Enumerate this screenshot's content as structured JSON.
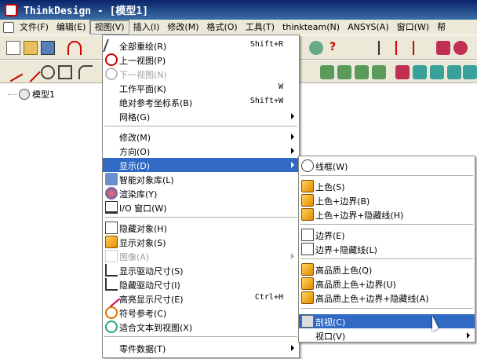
{
  "window": {
    "title": "ThinkDesign  - [模型1]"
  },
  "menubar": {
    "items": [
      "文件(F)",
      "编辑(E)",
      "视图(V)",
      "插入(I)",
      "修改(M)",
      "格式(O)",
      "工具(T)",
      "thinkteam(N)",
      "ANSYS(A)",
      "窗口(W)",
      "帮"
    ]
  },
  "tree": {
    "root_label": "模型1"
  },
  "view_menu": {
    "items": [
      {
        "label": "全部重绘(R)",
        "shortcut": "Shift+R",
        "icon": "redraw-icon"
      },
      {
        "label": "上一视图(P)",
        "icon": "previous-view-icon"
      },
      {
        "label": "下一视图(N)",
        "icon": "next-view-icon",
        "disabled": true
      },
      {
        "label": "工作平面(K)",
        "shortcut": "W"
      },
      {
        "label": "绝对参考坐标系(B)",
        "shortcut": "Shift+W"
      },
      {
        "label": "网格(G)",
        "submenu": true
      },
      {
        "label": "修改(M)",
        "submenu": true
      },
      {
        "label": "方向(O)",
        "submenu": true
      },
      {
        "label": "显示(D)",
        "submenu": true,
        "highlighted": true
      },
      {
        "label": "智能对象库(L)",
        "icon": "smart-object-library-icon"
      },
      {
        "label": "渲染库(Y)",
        "icon": "render-library-icon"
      },
      {
        "label": "I/O 窗口(W)",
        "icon": "io-window-icon"
      },
      {
        "label": "隐藏对象(H)",
        "icon": "hide-object-icon"
      },
      {
        "label": "显示对象(S)",
        "icon": "show-object-icon"
      },
      {
        "label": "图像(A)",
        "submenu": true,
        "disabled": true
      },
      {
        "label": "显示驱动尺寸(S)",
        "icon": "show-driving-dimension-icon"
      },
      {
        "label": "隐藏驱动尺寸(I)",
        "icon": "hide-driving-dimension-icon"
      },
      {
        "label": "高亮显示尺寸(E)",
        "shortcut": "Ctrl+H",
        "icon": "highlight-dimension-icon"
      },
      {
        "label": "符号参考(C)",
        "icon": "symbol-reference-icon"
      },
      {
        "label": "适合文本到视图(X)",
        "icon": "fit-text-to-view-icon"
      },
      {
        "label": "零件数据(T)",
        "submenu": true
      }
    ]
  },
  "display_submenu": {
    "items": [
      {
        "label": "线框(W)",
        "icon": "wireframe-icon"
      },
      {
        "label": "上色(S)",
        "icon": "shaded-icon"
      },
      {
        "label": "上色+边界(B)",
        "icon": "shaded-edges-icon"
      },
      {
        "label": "上色+边界+隐藏线(H)",
        "icon": "shaded-edges-hidden-icon"
      },
      {
        "label": "边界(E)",
        "icon": "edges-icon"
      },
      {
        "label": "边界+隐藏线(L)",
        "icon": "edges-hidden-icon"
      },
      {
        "label": "高品质上色(Q)",
        "icon": "hq-shaded-icon"
      },
      {
        "label": "高品质上色+边界(U)",
        "icon": "hq-shaded-edges-icon"
      },
      {
        "label": "高品质上色+边界+隐藏线(A)",
        "icon": "hq-shaded-edges-hidden-icon"
      },
      {
        "label": "剖视(C)",
        "icon": "section-view-icon",
        "highlighted": true
      },
      {
        "label": "视口(V)",
        "submenu": true
      }
    ]
  },
  "colors": {
    "highlight": "#316ac5",
    "menubar_bg": "#ece9d8",
    "title_bg": "#0a246a"
  }
}
